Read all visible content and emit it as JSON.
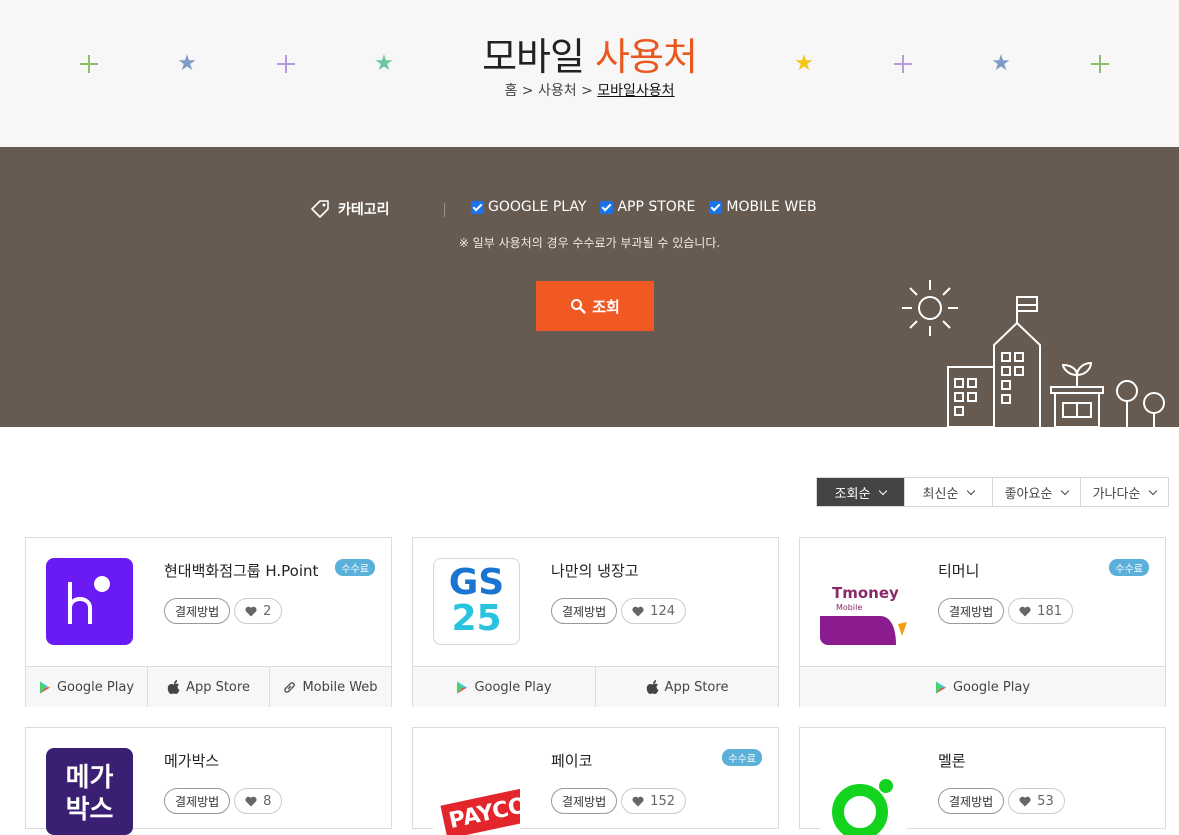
{
  "header": {
    "title_main": "모바일",
    "title_accent": "사용처",
    "breadcrumb": [
      "홈",
      "사용처",
      "모바일사용처"
    ],
    "colors": {
      "accent": "#e9581f",
      "band": "#665a51"
    }
  },
  "filter": {
    "category_label": "카테고리",
    "options": [
      {
        "label": "GOOGLE PLAY",
        "checked": true
      },
      {
        "label": "APP STORE",
        "checked": true
      },
      {
        "label": "MOBILE WEB",
        "checked": true
      }
    ],
    "note": "※ 일부 사용처의 경우 수수료가 부과될 수 있습니다.",
    "search_label": "조회"
  },
  "sort": [
    "조회순",
    "최신순",
    "좋아요순",
    "가나다순"
  ],
  "common": {
    "fee_badge": "수수료",
    "pay_label": "결제방법"
  },
  "cards": [
    {
      "name": "현대백화점그룹 H.Point",
      "fee": true,
      "likes": "2",
      "stores": [
        "Google Play",
        "App Store",
        "Mobile Web"
      ]
    },
    {
      "name": "나만의 냉장고",
      "fee": false,
      "likes": "124",
      "stores": [
        "Google Play",
        "App Store"
      ]
    },
    {
      "name": "티머니",
      "fee": true,
      "likes": "181",
      "stores": [
        "Google Play"
      ]
    },
    {
      "name": "메가박스",
      "fee": false,
      "likes": "8",
      "stores": []
    },
    {
      "name": "페이코",
      "fee": true,
      "likes": "152",
      "stores": []
    },
    {
      "name": "멜론",
      "fee": false,
      "likes": "53",
      "stores": []
    }
  ],
  "logos": {
    "gs_top": "GS",
    "gs_bottom": "25",
    "tmoney": "Tmoney",
    "tmoney_sub": "Mobile",
    "mega_top": "메가",
    "mega_bottom": "박스",
    "payco": "PAYCO"
  }
}
